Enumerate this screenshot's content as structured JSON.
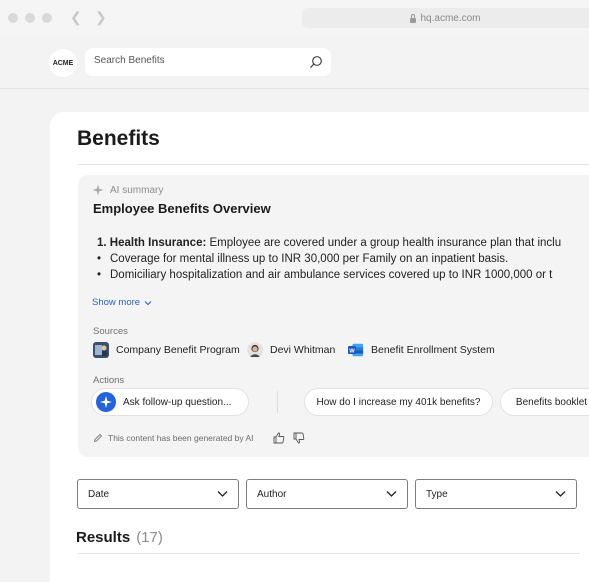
{
  "browser": {
    "url": "hq.acme.com"
  },
  "app": {
    "logo_text": "ACME"
  },
  "search": {
    "placeholder": "Search Benefits"
  },
  "page": {
    "title": "Benefits"
  },
  "ai_summary": {
    "label": "AI summary",
    "title": "Employee Benefits Overview",
    "item_number": "1.",
    "item_heading": "Health Insurance:",
    "item_text": " Employee are covered under a group health insurance plan that inclu",
    "bullets": [
      "Coverage for mental illness up to INR 30,000 per Family on an inpatient basis.",
      "Domiciliary hospitalization and air ambulance services covered up to INR 1000,000 or t"
    ],
    "show_more": "Show more",
    "sources_label": "Sources",
    "sources": [
      {
        "label": "Company Benefit Program",
        "icon": "document-thumbnail-icon"
      },
      {
        "label": "Devi Whitman",
        "icon": "person-avatar"
      },
      {
        "label": "Benefit Enrollment System",
        "icon": "word-document-icon"
      }
    ],
    "actions_label": "Actions",
    "actions": [
      "Ask follow-up question...",
      "How do I increase my 401k benefits?",
      "Benefits booklet"
    ],
    "disclaimer": "This content has been generated by AI"
  },
  "filters": [
    {
      "label": "Date"
    },
    {
      "label": "Author"
    },
    {
      "label": "Type"
    }
  ],
  "results": {
    "label": "Results",
    "count": "(17)"
  },
  "colors": {
    "link": "#2a64b3",
    "accent": "#2563d9",
    "word": "#2b579a"
  }
}
